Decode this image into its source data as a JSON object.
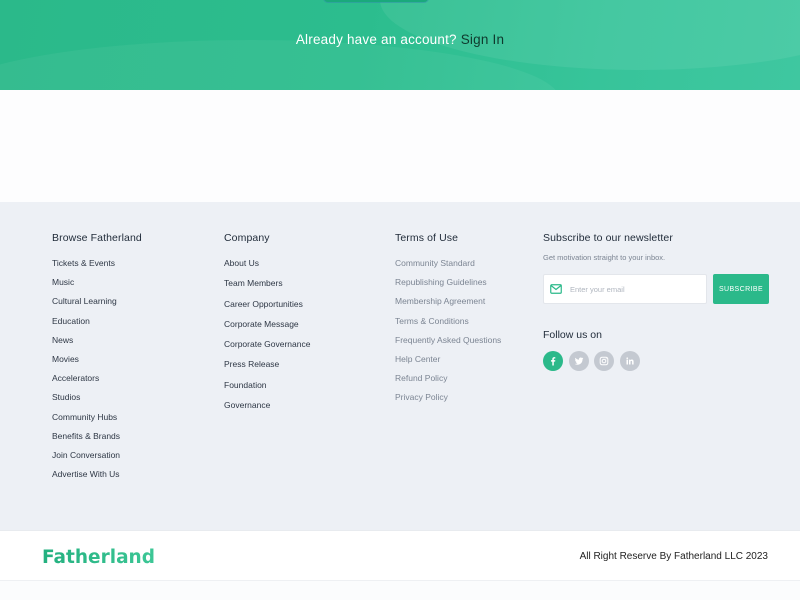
{
  "hero": {
    "prompt": "Already have an account?",
    "signin_label": "Sign In"
  },
  "footer": {
    "browse": {
      "title": "Browse Fatherland",
      "items": [
        "Tickets & Events",
        "Music",
        "Cultural Learning",
        "Education",
        "News",
        "Movies",
        "Accelerators",
        "Studios",
        "Community Hubs",
        "Benefits & Brands",
        "Join Conversation",
        "Advertise With Us"
      ]
    },
    "company": {
      "title": "Company",
      "items": [
        "About Us",
        "Team Members",
        "Career Opportunities",
        "Corporate Message",
        "Corporate Governance",
        "Press Release",
        "Foundation",
        "Governance"
      ]
    },
    "terms": {
      "title": "Terms of Use",
      "items": [
        "Community Standard",
        "Republishing Guidelines",
        "Membership Agreement",
        "Terms & Conditions",
        "Frequently Asked Questions",
        "Help Center",
        "Refund Policy",
        "Privacy Policy"
      ]
    },
    "newsletter": {
      "title": "Subscribe to our newsletter",
      "subtitle": "Get motivation straight to your inbox.",
      "email_placeholder": "Enter your email",
      "email_value": "",
      "subscribe_label": "SUBSCRIBE",
      "follow_title": "Follow us on",
      "socials": [
        "facebook-icon",
        "twitter-icon",
        "instagram-icon",
        "linkedin-icon"
      ]
    }
  },
  "bottom": {
    "logo_text": "Fatherland",
    "copyright": "All Right Reserve By Fatherland LLC 2023"
  },
  "colors": {
    "brand_green": "#2bb98a",
    "footer_bg": "#edf0f5",
    "icon_gray": "#c4c9d1"
  }
}
